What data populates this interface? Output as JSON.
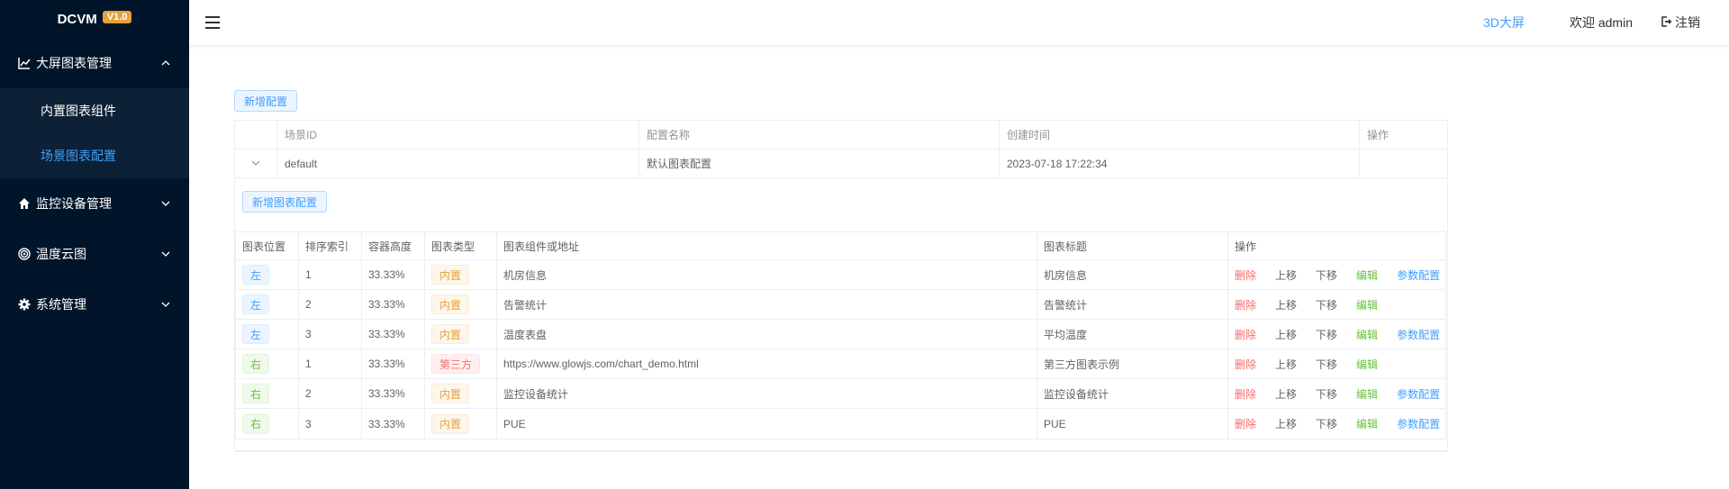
{
  "brand": {
    "name": "DCVM",
    "version": "V1.0"
  },
  "sidebar": {
    "groups": [
      {
        "label": "大屏图表管理",
        "icon": "line-chart-icon",
        "expanded": true,
        "items": [
          {
            "label": "内置图表组件"
          },
          {
            "label": "场景图表配置",
            "active": true
          }
        ]
      },
      {
        "label": "监控设备管理",
        "icon": "home-icon",
        "expanded": false
      },
      {
        "label": "温度云图",
        "icon": "eye-icon",
        "expanded": false
      },
      {
        "label": "系统管理",
        "icon": "gear-icon",
        "expanded": false
      }
    ]
  },
  "header": {
    "screen_link": "3D大屏",
    "welcome": "欢迎 admin",
    "logout": "注销"
  },
  "toolbar": {
    "add_config": "新增配置"
  },
  "outer_table": {
    "columns": [
      "场景ID",
      "配置名称",
      "创建时间",
      "操作"
    ],
    "rows": [
      {
        "scene_id": "default",
        "name": "默认图表配置",
        "created": "2023-07-18 17:22:34"
      }
    ]
  },
  "expanded": {
    "add_chart_config": "新增图表配置",
    "columns": [
      "图表位置",
      "排序索引",
      "容器高度",
      "图表类型",
      "图表组件或地址",
      "图表标题",
      "操作"
    ],
    "actions": {
      "delete": "删除",
      "up": "上移",
      "down": "下移",
      "edit": "编辑",
      "params": "参数配置"
    },
    "rows": [
      {
        "position": "左",
        "index": "1",
        "height": "33.33%",
        "type": "内置",
        "component": "机房信息",
        "title": "机房信息",
        "has_params": true
      },
      {
        "position": "左",
        "index": "2",
        "height": "33.33%",
        "type": "内置",
        "component": "告警统计",
        "title": "告警统计",
        "has_params": false
      },
      {
        "position": "左",
        "index": "3",
        "height": "33.33%",
        "type": "内置",
        "component": "温度表盘",
        "title": "平均温度",
        "has_params": true
      },
      {
        "position": "右",
        "index": "1",
        "height": "33.33%",
        "type": "第三方",
        "component": "https://www.glowjs.com/chart_demo.html",
        "title": "第三方图表示例",
        "has_params": false
      },
      {
        "position": "右",
        "index": "2",
        "height": "33.33%",
        "type": "内置",
        "component": "监控设备统计",
        "title": "监控设备统计",
        "has_params": true
      },
      {
        "position": "右",
        "index": "3",
        "height": "33.33%",
        "type": "内置",
        "component": "PUE",
        "title": "PUE",
        "has_params": true
      }
    ]
  },
  "colors": {
    "sidebar_bg": "#001529",
    "submenu_bg": "#0c2135",
    "accent": "#409eff",
    "brand_badge": "#e6a23c",
    "danger": "#f56c6c",
    "success": "#67c23a"
  }
}
